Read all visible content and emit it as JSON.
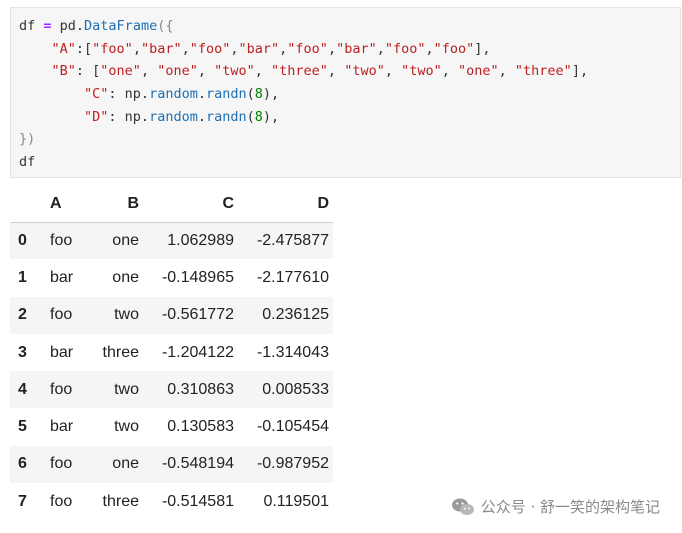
{
  "code_cell": {
    "lines": [
      [
        {
          "t": "df ",
          "c": "tok-punct"
        },
        {
          "t": "=",
          "c": "tok-op"
        },
        {
          "t": " pd.",
          "c": "tok-punct"
        },
        {
          "t": "DataFrame",
          "c": "tok-fn"
        },
        {
          "t": "({",
          "c": "tok-paren"
        }
      ],
      [
        {
          "t": "    ",
          "c": "tok-punct"
        },
        {
          "t": "\"A\"",
          "c": "tok-str"
        },
        {
          "t": ":[",
          "c": "tok-punct"
        },
        {
          "t": "\"foo\"",
          "c": "tok-str"
        },
        {
          "t": ",",
          "c": "tok-punct"
        },
        {
          "t": "\"bar\"",
          "c": "tok-str"
        },
        {
          "t": ",",
          "c": "tok-punct"
        },
        {
          "t": "\"foo\"",
          "c": "tok-str"
        },
        {
          "t": ",",
          "c": "tok-punct"
        },
        {
          "t": "\"bar\"",
          "c": "tok-str"
        },
        {
          "t": ",",
          "c": "tok-punct"
        },
        {
          "t": "\"foo\"",
          "c": "tok-str"
        },
        {
          "t": ",",
          "c": "tok-punct"
        },
        {
          "t": "\"bar\"",
          "c": "tok-str"
        },
        {
          "t": ",",
          "c": "tok-punct"
        },
        {
          "t": "\"foo\"",
          "c": "tok-str"
        },
        {
          "t": ",",
          "c": "tok-punct"
        },
        {
          "t": "\"foo\"",
          "c": "tok-str"
        },
        {
          "t": "],",
          "c": "tok-punct"
        }
      ],
      [
        {
          "t": "    ",
          "c": "tok-punct"
        },
        {
          "t": "\"B\"",
          "c": "tok-str"
        },
        {
          "t": ": [",
          "c": "tok-punct"
        },
        {
          "t": "\"one\"",
          "c": "tok-str"
        },
        {
          "t": ", ",
          "c": "tok-punct"
        },
        {
          "t": "\"one\"",
          "c": "tok-str"
        },
        {
          "t": ", ",
          "c": "tok-punct"
        },
        {
          "t": "\"two\"",
          "c": "tok-str"
        },
        {
          "t": ", ",
          "c": "tok-punct"
        },
        {
          "t": "\"three\"",
          "c": "tok-str"
        },
        {
          "t": ", ",
          "c": "tok-punct"
        },
        {
          "t": "\"two\"",
          "c": "tok-str"
        },
        {
          "t": ", ",
          "c": "tok-punct"
        },
        {
          "t": "\"two\"",
          "c": "tok-str"
        },
        {
          "t": ", ",
          "c": "tok-punct"
        },
        {
          "t": "\"one\"",
          "c": "tok-str"
        },
        {
          "t": ", ",
          "c": "tok-punct"
        },
        {
          "t": "\"three\"",
          "c": "tok-str"
        },
        {
          "t": "],",
          "c": "tok-punct"
        }
      ],
      [
        {
          "t": "        ",
          "c": "tok-punct"
        },
        {
          "t": "\"C\"",
          "c": "tok-str"
        },
        {
          "t": ": np.",
          "c": "tok-punct"
        },
        {
          "t": "random",
          "c": "tok-fn"
        },
        {
          "t": ".",
          "c": "tok-punct"
        },
        {
          "t": "randn",
          "c": "tok-fn"
        },
        {
          "t": "(",
          "c": "tok-punct"
        },
        {
          "t": "8",
          "c": "tok-num"
        },
        {
          "t": "),",
          "c": "tok-punct"
        }
      ],
      [
        {
          "t": "        ",
          "c": "tok-punct"
        },
        {
          "t": "\"D\"",
          "c": "tok-str"
        },
        {
          "t": ": np.",
          "c": "tok-punct"
        },
        {
          "t": "random",
          "c": "tok-fn"
        },
        {
          "t": ".",
          "c": "tok-punct"
        },
        {
          "t": "randn",
          "c": "tok-fn"
        },
        {
          "t": "(",
          "c": "tok-punct"
        },
        {
          "t": "8",
          "c": "tok-num"
        },
        {
          "t": "),",
          "c": "tok-punct"
        }
      ],
      [
        {
          "t": "})",
          "c": "tok-paren"
        }
      ],
      [
        {
          "t": "df",
          "c": "tok-punct"
        }
      ]
    ]
  },
  "dataframe": {
    "columns": [
      "A",
      "B",
      "C",
      "D"
    ],
    "rows": [
      {
        "index": "0",
        "A": "foo",
        "B": "one",
        "C": "1.062989",
        "D": "-2.475877"
      },
      {
        "index": "1",
        "A": "bar",
        "B": "one",
        "C": "-0.148965",
        "D": "-2.177610"
      },
      {
        "index": "2",
        "A": "foo",
        "B": "two",
        "C": "-0.561772",
        "D": "0.236125"
      },
      {
        "index": "3",
        "A": "bar",
        "B": "three",
        "C": "-1.204122",
        "D": "-1.314043"
      },
      {
        "index": "4",
        "A": "foo",
        "B": "two",
        "C": "0.310863",
        "D": "0.008533"
      },
      {
        "index": "5",
        "A": "bar",
        "B": "two",
        "C": "0.130583",
        "D": "-0.105454"
      },
      {
        "index": "6",
        "A": "foo",
        "B": "one",
        "C": "-0.548194",
        "D": "-0.987952"
      },
      {
        "index": "7",
        "A": "foo",
        "B": "three",
        "C": "-0.514581",
        "D": "0.119501"
      }
    ]
  },
  "watermark": {
    "icon": "wechat-icon",
    "text": "公众号 · 舒一笑的架构笔记"
  }
}
